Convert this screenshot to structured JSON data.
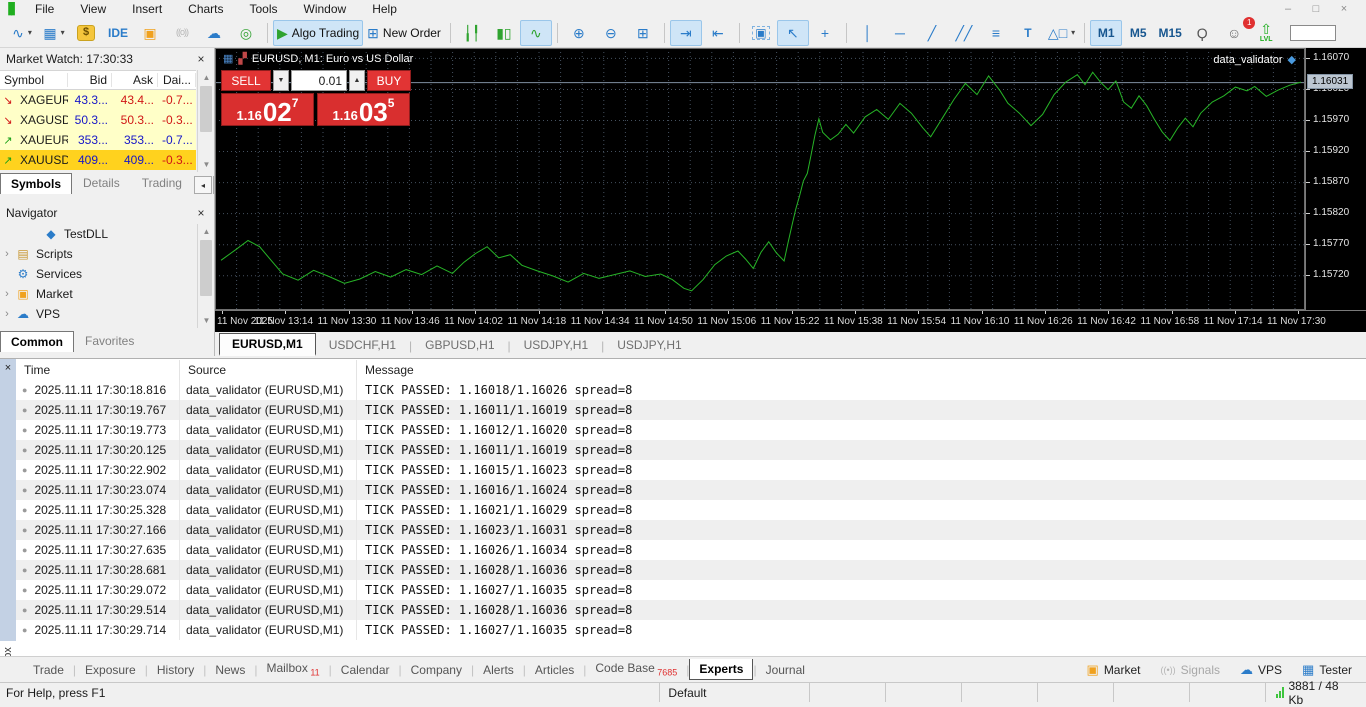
{
  "menu": {
    "items": [
      "File",
      "View",
      "Insert",
      "Charts",
      "Tools",
      "Window",
      "Help"
    ],
    "window_controls": [
      {
        "name": "minimize-button",
        "glyph": "–"
      },
      {
        "name": "restore-button",
        "glyph": "□"
      },
      {
        "name": "close-button",
        "glyph": "×"
      }
    ]
  },
  "toolbar": {
    "items": [
      {
        "name": "chart-type-button",
        "glyph": "∿",
        "color": "#2b7cc9",
        "dropdown": true
      },
      {
        "name": "indicators-button",
        "glyph": "▦",
        "color": "#2b7cc9",
        "dropdown": true
      },
      {
        "name": "quotes-button",
        "glyph": "$",
        "chip": true,
        "color": "#6b4e00"
      },
      {
        "name": "ide-button",
        "glyph": "IDE",
        "txt": true,
        "color": "#2b7cc9"
      },
      {
        "name": "market-store-button",
        "glyph": "▣",
        "color": "#f0a11e"
      },
      {
        "name": "signals-button",
        "glyph": "((o))",
        "small": true,
        "color": "#b4b4b4"
      },
      {
        "name": "vps-cloud-button",
        "glyph": "☁",
        "color": "#2b7cc9"
      },
      {
        "name": "community-button",
        "glyph": "◎",
        "color": "#36a336"
      },
      {
        "sep": true
      },
      {
        "name": "algo-trading-button",
        "glyph": "▶",
        "color": "#2fa32f",
        "label": "Algo Trading",
        "active": true
      },
      {
        "name": "new-order-button",
        "glyph": "⊞",
        "color": "#2b7cc9",
        "label": "New Order"
      },
      {
        "sep": true
      },
      {
        "name": "bar-chart-button",
        "glyph": "╽╿",
        "color": "#2fa32f"
      },
      {
        "name": "candlestick-chart-button",
        "glyph": "▮▯",
        "color": "#2fa32f"
      },
      {
        "name": "line-chart-button",
        "glyph": "∿",
        "color": "#2fa32f",
        "active": true
      },
      {
        "sep": true
      },
      {
        "name": "zoom-in-button",
        "glyph": "⊕",
        "color": "#2b7cc9"
      },
      {
        "name": "zoom-out-button",
        "glyph": "⊖",
        "color": "#2b7cc9"
      },
      {
        "name": "tile-windows-button",
        "glyph": "⊞",
        "color": "#2b7cc9"
      },
      {
        "sep": true
      },
      {
        "name": "chart-shift-button",
        "glyph": "⇥",
        "color": "#2b7cc9",
        "active": true
      },
      {
        "name": "auto-scroll-button",
        "glyph": "⇤",
        "color": "#2b7cc9"
      },
      {
        "sep": true
      },
      {
        "name": "screenshot-button",
        "glyph": "▣",
        "color": "#2b7cc9",
        "dashed": true
      },
      {
        "name": "cursor-button",
        "glyph": "↖",
        "color": "#2b7cc9",
        "active": true
      },
      {
        "name": "crosshair-button",
        "glyph": "+",
        "color": "#2b7cc9"
      },
      {
        "sep": true
      },
      {
        "name": "vertical-line-button",
        "glyph": "│",
        "color": "#2b7cc9"
      },
      {
        "name": "horizontal-line-button",
        "glyph": "─",
        "color": "#2b7cc9"
      },
      {
        "name": "trendline-button",
        "glyph": "╱",
        "color": "#2b7cc9"
      },
      {
        "name": "channel-button",
        "glyph": "╱╱",
        "color": "#2b7cc9"
      },
      {
        "name": "fibonacci-button",
        "glyph": "≡",
        "color": "#2b7cc9"
      },
      {
        "name": "text-tool-button",
        "glyph": "T",
        "txt": true,
        "color": "#2b7cc9"
      },
      {
        "name": "shapes-button",
        "glyph": "△□",
        "color": "#2b7cc9",
        "dropdown": true
      },
      {
        "sep": true
      },
      {
        "name": "timeframe-m1-button",
        "glyph": "M1",
        "txt": true,
        "color": "#17568f",
        "active": true
      },
      {
        "name": "timeframe-m5-button",
        "glyph": "M5",
        "txt": true,
        "color": "#17568f"
      },
      {
        "name": "timeframe-m15-button",
        "glyph": "M15",
        "txt": true,
        "color": "#17568f"
      },
      {
        "name": "search-button",
        "glyph": "Ϙ",
        "color": "#555"
      },
      {
        "name": "notifications-button",
        "glyph": "☺",
        "color": "#666",
        "badge": "1"
      },
      {
        "name": "lvl-button",
        "glyph": "⇧",
        "color": "#1fae1f",
        "sub": "LVL"
      },
      {
        "name": "connection-meter",
        "meter": 42
      }
    ]
  },
  "market_watch": {
    "title": "Market Watch: 17:30:33",
    "close": "×",
    "columns": [
      "Symbol",
      "Bid",
      "Ask",
      "Dai..."
    ],
    "rows": [
      {
        "symbol": "XAGEUR",
        "dir": "down",
        "bid": "43.3...",
        "ask": "43.4...",
        "daily": "-0.7...",
        "bid_color": "#1616c8",
        "ask_color": "#d01616",
        "daily_color": "#d01616",
        "bg": "#ffffc8"
      },
      {
        "symbol": "XAGUSD",
        "dir": "down",
        "bid": "50.3...",
        "ask": "50.3...",
        "daily": "-0.3...",
        "bid_color": "#1616c8",
        "ask_color": "#d01616",
        "daily_color": "#d01616",
        "bg": "#ffffc8"
      },
      {
        "symbol": "XAUEUR",
        "dir": "up",
        "bid": "353...",
        "ask": "353...",
        "daily": "-0.7...",
        "bid_color": "#1616c8",
        "ask_color": "#1616c8",
        "daily_color": "#1616c8",
        "bg": "#ffffc8"
      },
      {
        "symbol": "XAUUSD",
        "dir": "up",
        "bid": "409...",
        "ask": "409...",
        "daily": "-0.3...",
        "bid_color": "#1616c8",
        "ask_color": "#1616c8",
        "daily_color": "#d01616",
        "bg": "#ffd21e"
      }
    ],
    "tabs": [
      {
        "label": "Symbols",
        "active": true
      },
      {
        "label": "Details"
      },
      {
        "label": "Trading"
      }
    ]
  },
  "navigator": {
    "title": "Navigator",
    "close": "×",
    "items": [
      {
        "label": "TestDLL",
        "icon": "expert-icon",
        "glyph": "◆",
        "color": "#2b7cc9",
        "indent": true
      },
      {
        "label": "Scripts",
        "icon": "scripts-folder-icon",
        "glyph": "▤",
        "color": "#c89632",
        "expander": true
      },
      {
        "label": "Services",
        "icon": "services-gear-icon",
        "glyph": "⚙",
        "color": "#2b7cc9"
      },
      {
        "label": "Market",
        "icon": "market-bag-icon",
        "glyph": "▣",
        "color": "#f0a11e",
        "expander": true
      },
      {
        "label": "VPS",
        "icon": "vps-cloud-icon",
        "glyph": "☁",
        "color": "#2b7cc9",
        "expander": true
      }
    ],
    "tabs": [
      {
        "label": "Common",
        "active": true
      },
      {
        "label": "Favorites"
      }
    ]
  },
  "chart": {
    "title": "EURUSD, M1: Euro vs US Dollar",
    "ea_name": "data_validator",
    "trade": {
      "sell": "SELL",
      "buy": "BUY",
      "volume": "0.01",
      "sell_price": [
        "1.16",
        "02",
        "7"
      ],
      "buy_price": [
        "1.16",
        "03",
        "5"
      ]
    },
    "current_price_label": "1.16031",
    "tabs": [
      {
        "label": "EURUSD,M1",
        "active": true
      },
      {
        "label": "USDCHF,H1"
      },
      {
        "label": "GBPUSD,H1"
      },
      {
        "label": "USDJPY,H1"
      },
      {
        "label": "USDJPY,H1"
      }
    ]
  },
  "chart_data": {
    "type": "line",
    "symbol": "EURUSD",
    "timeframe": "M1",
    "title": "EURUSD, M1: Euro vs US Dollar",
    "line_color": "#27b427",
    "background": "#000000",
    "grid": true,
    "y_ticks": [
      1.1607,
      1.1602,
      1.1597,
      1.1592,
      1.1587,
      1.1582,
      1.1577,
      1.1572
    ],
    "y_range": [
      1.15664,
      1.16086
    ],
    "current_price": 1.16031,
    "x_labels": [
      "11 Nov 2025",
      "11 Nov 13:14",
      "11 Nov 13:30",
      "11 Nov 13:46",
      "11 Nov 14:02",
      "11 Nov 14:18",
      "11 Nov 14:34",
      "11 Nov 14:50",
      "11 Nov 15:06",
      "11 Nov 15:22",
      "11 Nov 15:38",
      "11 Nov 15:54",
      "11 Nov 16:10",
      "11 Nov 16:26",
      "11 Nov 16:42",
      "11 Nov 16:58",
      "11 Nov 17:14",
      "11 Nov 17:30"
    ],
    "x_minutes_range": [
      0,
      280
    ],
    "points": [
      [
        0,
        1.15744
      ],
      [
        4,
        1.15762
      ],
      [
        7,
        1.15776
      ],
      [
        10,
        1.15766
      ],
      [
        13,
        1.15744
      ],
      [
        16,
        1.15722
      ],
      [
        20,
        1.15712
      ],
      [
        24,
        1.15728
      ],
      [
        28,
        1.15718
      ],
      [
        32,
        1.15707
      ],
      [
        36,
        1.15714
      ],
      [
        40,
        1.15726
      ],
      [
        44,
        1.15717
      ],
      [
        48,
        1.15729
      ],
      [
        52,
        1.15721
      ],
      [
        56,
        1.15735
      ],
      [
        60,
        1.15723
      ],
      [
        63,
        1.15741
      ],
      [
        66,
        1.15755
      ],
      [
        69,
        1.15766
      ],
      [
        72,
        1.15748
      ],
      [
        75,
        1.15753
      ],
      [
        78,
        1.15736
      ],
      [
        82,
        1.15727
      ],
      [
        86,
        1.15719
      ],
      [
        90,
        1.15709
      ],
      [
        94,
        1.15723
      ],
      [
        98,
        1.15715
      ],
      [
        102,
        1.15721
      ],
      [
        106,
        1.15727
      ],
      [
        110,
        1.15718
      ],
      [
        114,
        1.15722
      ],
      [
        117,
        1.15713
      ],
      [
        120,
        1.15699
      ],
      [
        122,
        1.15695
      ],
      [
        125,
        1.15713
      ],
      [
        128,
        1.15737
      ],
      [
        131,
        1.15751
      ],
      [
        134,
        1.15759
      ],
      [
        136,
        1.15746
      ],
      [
        138,
        1.15731
      ],
      [
        140,
        1.15757
      ],
      [
        142,
        1.15774
      ],
      [
        144,
        1.15756
      ],
      [
        146,
        1.15743
      ],
      [
        147,
        1.15772
      ],
      [
        148,
        1.158
      ],
      [
        149,
        1.15826
      ],
      [
        150,
        1.15848
      ],
      [
        151,
        1.15872
      ],
      [
        152,
        1.15884
      ],
      [
        153,
        1.15914
      ],
      [
        154,
        1.15946
      ],
      [
        155,
        1.15972
      ],
      [
        156,
        1.1595
      ],
      [
        158,
        1.15938
      ],
      [
        160,
        1.15947
      ],
      [
        162,
        1.15963
      ],
      [
        164,
        1.15949
      ],
      [
        167,
        1.15975
      ],
      [
        170,
        1.15987
      ],
      [
        173,
        1.15971
      ],
      [
        176,
        1.15997
      ],
      [
        179,
        1.15981
      ],
      [
        182,
        1.15957
      ],
      [
        184,
        1.15943
      ],
      [
        187,
        1.15973
      ],
      [
        190,
        1.16003
      ],
      [
        193,
        1.16029
      ],
      [
        196,
        1.16011
      ],
      [
        199,
        1.16041
      ],
      [
        202,
        1.16017
      ],
      [
        204,
        1.15997
      ],
      [
        207,
        1.15981
      ],
      [
        210,
        1.15961
      ],
      [
        213,
        1.15979
      ],
      [
        216,
        1.16011
      ],
      [
        219,
        1.16031
      ],
      [
        222,
        1.16043
      ],
      [
        224,
        1.16027
      ],
      [
        226,
        1.16047
      ],
      [
        228,
        1.16031
      ],
      [
        230,
        1.16019
      ],
      [
        232,
        1.16033
      ],
      [
        234,
        1.15999
      ],
      [
        236,
        1.15989
      ],
      [
        238,
        1.16009
      ],
      [
        240,
        1.15993
      ],
      [
        242,
        1.15971
      ],
      [
        244,
        1.15951
      ],
      [
        246,
        1.15937
      ],
      [
        248,
        1.15957
      ],
      [
        250,
        1.15973
      ],
      [
        252,
        1.15959
      ],
      [
        254,
        1.15981
      ],
      [
        257,
        1.15999
      ],
      [
        260,
        1.16009
      ],
      [
        263,
        1.16023
      ],
      [
        266,
        1.16017
      ],
      [
        268,
        1.16024
      ],
      [
        271,
        1.16008
      ],
      [
        274,
        1.16018
      ],
      [
        277,
        1.16026
      ],
      [
        280,
        1.16031
      ]
    ]
  },
  "toolbox": {
    "gutter_label": "Toolbox",
    "close": "×",
    "columns": [
      "Time",
      "Source",
      "Message"
    ],
    "rows": [
      {
        "time": "2025.11.11 17:30:18.816",
        "source": "data_validator (EURUSD,M1)",
        "message": "TICK PASSED: 1.16018/1.16026 spread=8"
      },
      {
        "time": "2025.11.11 17:30:19.767",
        "source": "data_validator (EURUSD,M1)",
        "message": "TICK PASSED: 1.16011/1.16019 spread=8"
      },
      {
        "time": "2025.11.11 17:30:19.773",
        "source": "data_validator (EURUSD,M1)",
        "message": "TICK PASSED: 1.16012/1.16020 spread=8"
      },
      {
        "time": "2025.11.11 17:30:20.125",
        "source": "data_validator (EURUSD,M1)",
        "message": "TICK PASSED: 1.16011/1.16019 spread=8"
      },
      {
        "time": "2025.11.11 17:30:22.902",
        "source": "data_validator (EURUSD,M1)",
        "message": "TICK PASSED: 1.16015/1.16023 spread=8"
      },
      {
        "time": "2025.11.11 17:30:23.074",
        "source": "data_validator (EURUSD,M1)",
        "message": "TICK PASSED: 1.16016/1.16024 spread=8"
      },
      {
        "time": "2025.11.11 17:30:25.328",
        "source": "data_validator (EURUSD,M1)",
        "message": "TICK PASSED: 1.16021/1.16029 spread=8"
      },
      {
        "time": "2025.11.11 17:30:27.166",
        "source": "data_validator (EURUSD,M1)",
        "message": "TICK PASSED: 1.16023/1.16031 spread=8"
      },
      {
        "time": "2025.11.11 17:30:27.635",
        "source": "data_validator (EURUSD,M1)",
        "message": "TICK PASSED: 1.16026/1.16034 spread=8"
      },
      {
        "time": "2025.11.11 17:30:28.681",
        "source": "data_validator (EURUSD,M1)",
        "message": "TICK PASSED: 1.16028/1.16036 spread=8"
      },
      {
        "time": "2025.11.11 17:30:29.072",
        "source": "data_validator (EURUSD,M1)",
        "message": "TICK PASSED: 1.16027/1.16035 spread=8"
      },
      {
        "time": "2025.11.11 17:30:29.514",
        "source": "data_validator (EURUSD,M1)",
        "message": "TICK PASSED: 1.16028/1.16036 spread=8"
      },
      {
        "time": "2025.11.11 17:30:29.714",
        "source": "data_validator (EURUSD,M1)",
        "message": "TICK PASSED: 1.16027/1.16035 spread=8"
      }
    ],
    "tabs": [
      {
        "label": "Trade"
      },
      {
        "label": "Exposure"
      },
      {
        "label": "History"
      },
      {
        "label": "News"
      },
      {
        "label": "Mailbox",
        "badge": "11"
      },
      {
        "label": "Calendar"
      },
      {
        "label": "Company"
      },
      {
        "label": "Alerts"
      },
      {
        "label": "Articles"
      },
      {
        "label": "Code Base",
        "badge": "7685"
      },
      {
        "label": "Experts",
        "active": true
      },
      {
        "label": "Journal"
      }
    ],
    "right_buttons": [
      {
        "name": "market-button",
        "label": "Market",
        "glyph": "▣",
        "color": "#f0a11e"
      },
      {
        "name": "signals-button",
        "label": "Signals",
        "glyph": "((•))",
        "color": "#b4b4b4",
        "muted": true
      },
      {
        "name": "vps-button",
        "label": "VPS",
        "glyph": "☁",
        "color": "#2b7cc9"
      },
      {
        "name": "tester-button",
        "label": "Tester",
        "glyph": "▦",
        "color": "#2b7cc9"
      }
    ]
  },
  "status_bar": {
    "help": "For Help, press F1",
    "profile": "Default",
    "empty_cells": 6,
    "traffic": "3881 / 48 Kb"
  }
}
